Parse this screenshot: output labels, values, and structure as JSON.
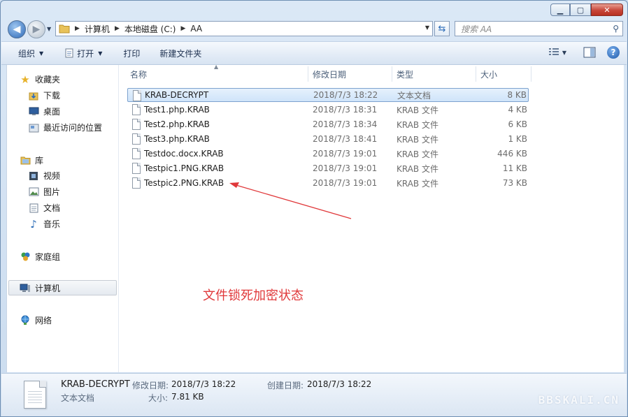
{
  "window": {
    "minimize": "▁",
    "maximize": "▢",
    "close": "✕"
  },
  "address": {
    "crumbs": [
      "计算机",
      "本地磁盘 (C:)",
      "AA"
    ]
  },
  "search": {
    "placeholder": "搜索 AA"
  },
  "toolbar": {
    "organize": "组织",
    "open": "打开",
    "print": "打印",
    "new_folder": "新建文件夹"
  },
  "nav": {
    "favorites": "收藏夹",
    "downloads": "下载",
    "desktop": "桌面",
    "recent": "最近访问的位置",
    "libraries": "库",
    "videos": "视频",
    "pictures": "图片",
    "documents": "文档",
    "music": "音乐",
    "homegroup": "家庭组",
    "computer": "计算机",
    "network": "网络"
  },
  "columns": {
    "name": "名称",
    "date": "修改日期",
    "type": "类型",
    "size": "大小"
  },
  "files": [
    {
      "name": "KRAB-DECRYPT",
      "date": "2018/7/3 18:22",
      "type": "文本文档",
      "size": "8 KB"
    },
    {
      "name": "Test1.php.KRAB",
      "date": "2018/7/3 18:31",
      "type": "KRAB 文件",
      "size": "4 KB"
    },
    {
      "name": "Test2.php.KRAB",
      "date": "2018/7/3 18:34",
      "type": "KRAB 文件",
      "size": "6 KB"
    },
    {
      "name": "Test3.php.KRAB",
      "date": "2018/7/3 18:41",
      "type": "KRAB 文件",
      "size": "1 KB"
    },
    {
      "name": "Testdoc.docx.KRAB",
      "date": "2018/7/3 19:01",
      "type": "KRAB 文件",
      "size": "446 KB"
    },
    {
      "name": "Testpic1.PNG.KRAB",
      "date": "2018/7/3 19:01",
      "type": "KRAB 文件",
      "size": "11 KB"
    },
    {
      "name": "Testpic2.PNG.KRAB",
      "date": "2018/7/3 19:01",
      "type": "KRAB 文件",
      "size": "73 KB"
    }
  ],
  "annotation": "文件锁死加密状态",
  "details": {
    "name": "KRAB-DECRYPT",
    "type": "文本文档",
    "modified_label": "修改日期:",
    "modified": "2018/7/3 18:22",
    "created_label": "创建日期:",
    "created": "2018/7/3 18:22",
    "size_label": "大小:",
    "size": "7.81 KB"
  },
  "watermark": "BBSKALI.CN",
  "colors": {
    "annotation": "#e0383a",
    "selection": "#cfe4fa"
  }
}
